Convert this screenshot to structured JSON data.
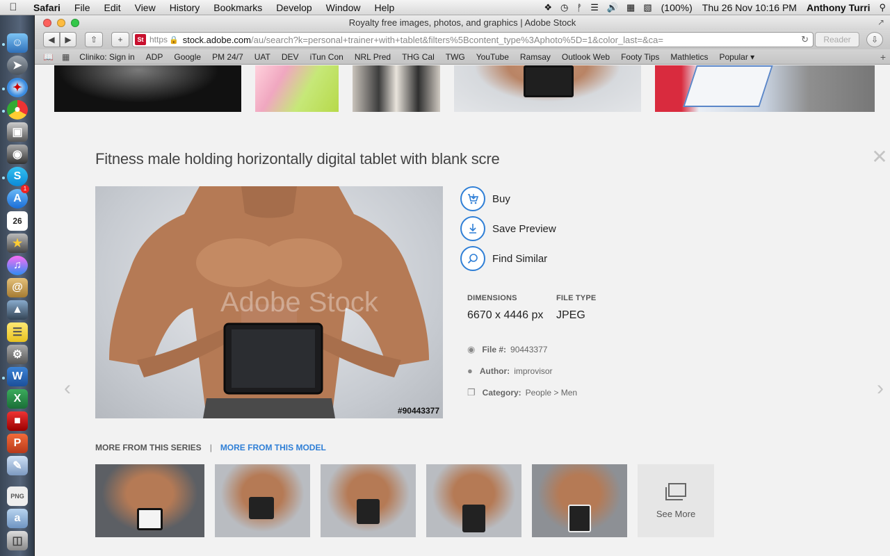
{
  "menubar": {
    "app": "Safari",
    "items": [
      "File",
      "Edit",
      "View",
      "History",
      "Bookmarks",
      "Develop",
      "Window",
      "Help"
    ],
    "battery": "(100%)",
    "clock": "Thu 26 Nov  10:16 PM",
    "user": "Anthony Turri"
  },
  "dock": {
    "calendar_day": "26",
    "badge_appstore": "1"
  },
  "browser": {
    "window_title": "Royalty free images, photos, and graphics | Adobe Stock",
    "site_badge": "St",
    "url_scheme": "https",
    "url_domain": "stock.adobe.com",
    "url_path": "/au/search?k=personal+trainer+with+tablet&filters%5Bcontent_type%3Aphoto%5D=1&color_last=&ca=",
    "reader_label": "Reader",
    "bookmarks": [
      "Cliniko: Sign in",
      "ADP",
      "Google",
      "PM 24/7",
      "UAT",
      "DEV",
      "iTun Con",
      "NRL Pred",
      "THG Cal",
      "TWG",
      "YouTube",
      "Ramsay",
      "Outlook Web",
      "Footy Tips",
      "Mathletics",
      "Popular ▾"
    ]
  },
  "detail": {
    "title": "Fitness male holding horizontally digital tablet with blank scre",
    "watermark": "Adobe Stock",
    "image_id": "#90443377",
    "actions": {
      "buy": "Buy",
      "save_preview": "Save Preview",
      "find_similar": "Find Similar"
    },
    "dimensions_label": "DIMENSIONS",
    "dimensions_value": "6670 x 4446 px",
    "filetype_label": "FILE TYPE",
    "filetype_value": "JPEG",
    "file_label": "File #:",
    "file_value": "90443377",
    "author_label": "Author:",
    "author_value": "improvisor",
    "category_label": "Category:",
    "category_value": "People > Men"
  },
  "series": {
    "tab_series": "MORE FROM THIS SERIES",
    "separator": "|",
    "tab_model": "MORE FROM THIS MODEL",
    "see_more": "See More"
  },
  "colors": {
    "accent": "#2f7fd6"
  }
}
